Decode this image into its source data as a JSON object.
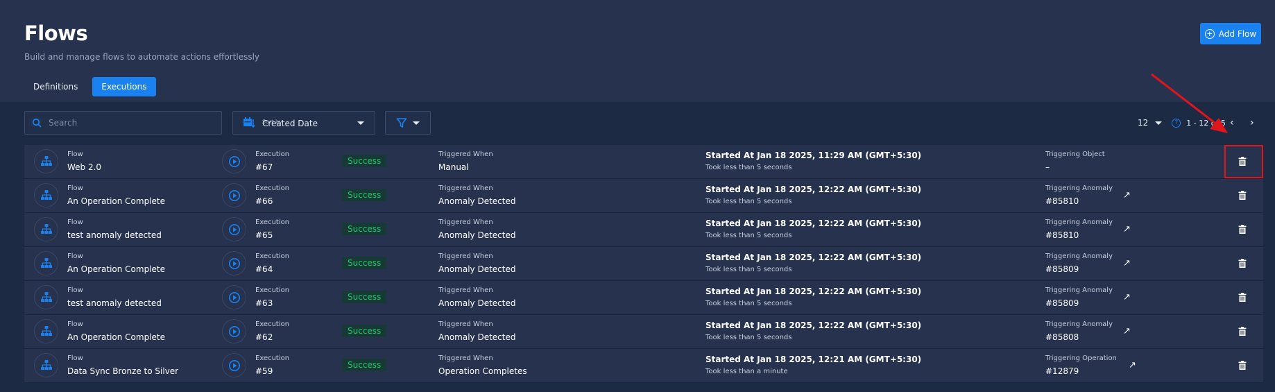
{
  "header": {
    "title": "Flows",
    "subtitle": "Build and manage flows to automate actions effortlessly",
    "add_button": "Add Flow",
    "tabs": [
      {
        "label": "Definitions"
      },
      {
        "label": "Executions"
      }
    ]
  },
  "toolbar": {
    "search_placeholder": "Search",
    "sort_label": "Sort by",
    "sort_value": "Created Date",
    "page_size": "12",
    "range": "1 - 12 of 5"
  },
  "colors": {
    "accent": "#1a82f0",
    "success_text": "#24c468",
    "highlight": "#e0161c",
    "background": "#1d2a44",
    "row": "#26324e"
  },
  "labels": {
    "flow": "Flow",
    "execution": "Execution",
    "triggered_when": "Triggered When"
  },
  "rows": [
    {
      "flow": "Web 2.0",
      "execution": "#67",
      "status": "Success",
      "trigger": "Manual",
      "started": "Started At Jan 18 2025, 11:29 AM (GMT+5:30)",
      "took": "Took less than 5 seconds",
      "obj_label": "Triggering Object",
      "obj_value": "–",
      "link": false
    },
    {
      "flow": "An Operation Complete",
      "execution": "#66",
      "status": "Success",
      "trigger": "Anomaly Detected",
      "started": "Started At Jan 18 2025, 12:22 AM (GMT+5:30)",
      "took": "Took less than 5 seconds",
      "obj_label": "Triggering Anomaly",
      "obj_value": "#85810",
      "link": true
    },
    {
      "flow": "test anomaly detected",
      "execution": "#65",
      "status": "Success",
      "trigger": "Anomaly Detected",
      "started": "Started At Jan 18 2025, 12:22 AM (GMT+5:30)",
      "took": "Took less than 5 seconds",
      "obj_label": "Triggering Anomaly",
      "obj_value": "#85810",
      "link": true
    },
    {
      "flow": "An Operation Complete",
      "execution": "#64",
      "status": "Success",
      "trigger": "Anomaly Detected",
      "started": "Started At Jan 18 2025, 12:22 AM (GMT+5:30)",
      "took": "Took less than 5 seconds",
      "obj_label": "Triggering Anomaly",
      "obj_value": "#85809",
      "link": true
    },
    {
      "flow": "test anomaly detected",
      "execution": "#63",
      "status": "Success",
      "trigger": "Anomaly Detected",
      "started": "Started At Jan 18 2025, 12:22 AM (GMT+5:30)",
      "took": "Took less than 5 seconds",
      "obj_label": "Triggering Anomaly",
      "obj_value": "#85809",
      "link": true
    },
    {
      "flow": "An Operation Complete",
      "execution": "#62",
      "status": "Success",
      "trigger": "Anomaly Detected",
      "started": "Started At Jan 18 2025, 12:22 AM (GMT+5:30)",
      "took": "Took less than 5 seconds",
      "obj_label": "Triggering Anomaly",
      "obj_value": "#85808",
      "link": true
    },
    {
      "flow": "Data Sync Bronze to Silver",
      "execution": "#59",
      "status": "Success",
      "trigger": "Operation Completes",
      "started": "Started At Jan 18 2025, 12:21 AM (GMT+5:30)",
      "took": "Took less than a minute",
      "obj_label": "Triggering Operation",
      "obj_value": "#12879",
      "link": true
    }
  ]
}
